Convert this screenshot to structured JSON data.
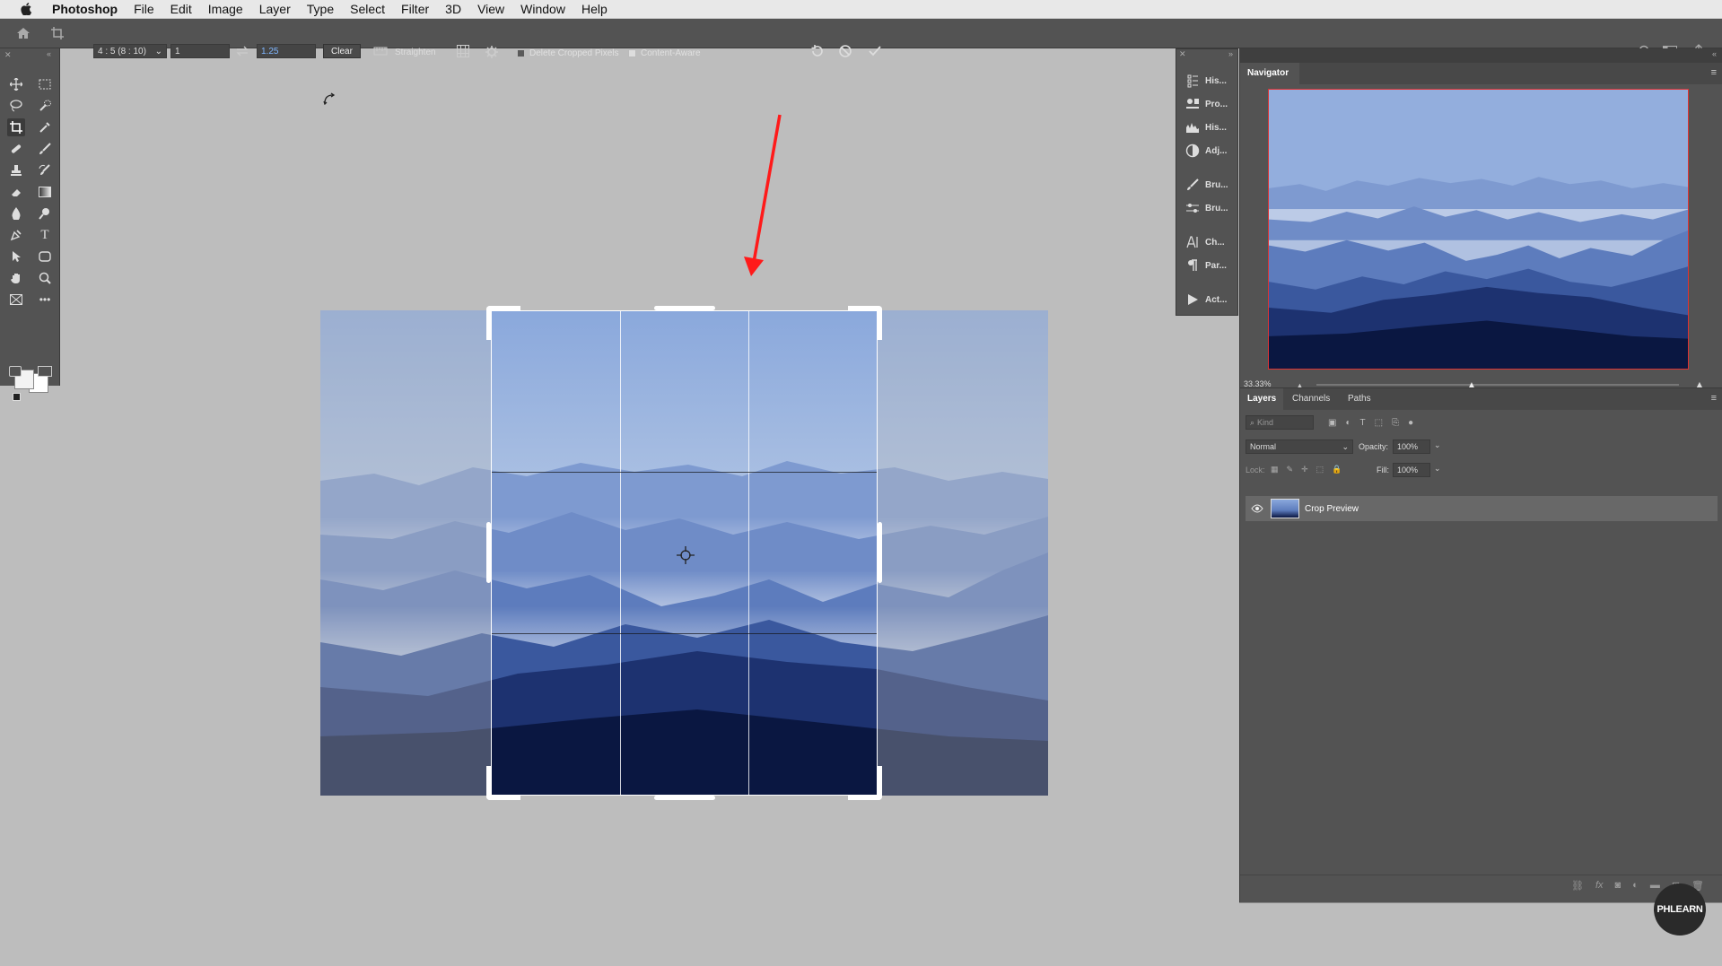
{
  "app": {
    "name": "Photoshop"
  },
  "menu": [
    "File",
    "Edit",
    "Image",
    "Layer",
    "Type",
    "Select",
    "Filter",
    "3D",
    "View",
    "Window",
    "Help"
  ],
  "options": {
    "ratio": "4 : 5 (8 : 10)",
    "width_value": "1",
    "height_value": "1.25",
    "clear_label": "Clear",
    "straighten_label": "Straighten",
    "delete_cropped_label": "Delete Cropped Pixels",
    "delete_cropped_checked": false,
    "content_aware_label": "Content-Aware",
    "content_aware_checked": true
  },
  "panel_strip": [
    "His...",
    "Pro...",
    "His...",
    "Adj...",
    "Bru...",
    "Bru...",
    "Ch...",
    "Par...",
    "Act..."
  ],
  "navigator": {
    "title": "Navigator",
    "zoom": "33.33%"
  },
  "layers": {
    "tabs": [
      "Layers",
      "Channels",
      "Paths"
    ],
    "kind_placeholder": "Kind",
    "blend_mode": "Normal",
    "opacity_label": "Opacity:",
    "opacity_value": "100%",
    "lock_label": "Lock:",
    "fill_label": "Fill:",
    "fill_value": "100%",
    "items": [
      {
        "name": "Crop Preview",
        "visible": true
      }
    ]
  },
  "watermark": "PHLEARN",
  "colors": {
    "accent_arrow": "#ff1a1a",
    "panel": "#535353",
    "canvas": "#bdbdbd"
  }
}
